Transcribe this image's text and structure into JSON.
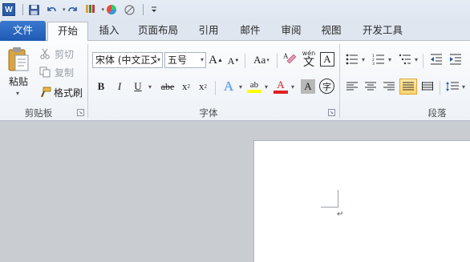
{
  "qat": {
    "icons": [
      "word-logo",
      "save-icon",
      "undo-icon",
      "redo-icon",
      "format-painter-icon",
      "color-wheel-icon",
      "clear-icon",
      "customize-icon"
    ],
    "word_logo_text": "W"
  },
  "tabs": [
    {
      "label": "文件"
    },
    {
      "label": "开始"
    },
    {
      "label": "插入"
    },
    {
      "label": "页面布局"
    },
    {
      "label": "引用"
    },
    {
      "label": "邮件"
    },
    {
      "label": "审阅"
    },
    {
      "label": "视图"
    },
    {
      "label": "开发工具"
    }
  ],
  "clipboard": {
    "paste_label": "粘贴",
    "cut_label": "剪切",
    "copy_label": "复制",
    "format_painter_label": "格式刷",
    "group_label": "剪贴板"
  },
  "font": {
    "font_name": "宋体 (中文正文)",
    "font_size": "五号",
    "grow_font": "A",
    "shrink_font": "A",
    "change_case": "Aa",
    "pinyin": "wén",
    "char_border": "A",
    "bold": "B",
    "italic": "I",
    "underline": "U",
    "strikethrough": "abe",
    "subscript": "x",
    "superscript": "x",
    "text_effects": "A",
    "highlight": "ab",
    "font_color": "A",
    "char_shading": "A",
    "enclose_char": "字",
    "group_label": "字体"
  },
  "paragraph": {
    "group_label": "段落"
  },
  "colors": {
    "file_tab": "#2b63bd",
    "highlight_yellow": "#ffff00",
    "font_red": "#e02020",
    "selected_align": "#fbd56c"
  },
  "document": {
    "paragraph_mark": "↵"
  }
}
